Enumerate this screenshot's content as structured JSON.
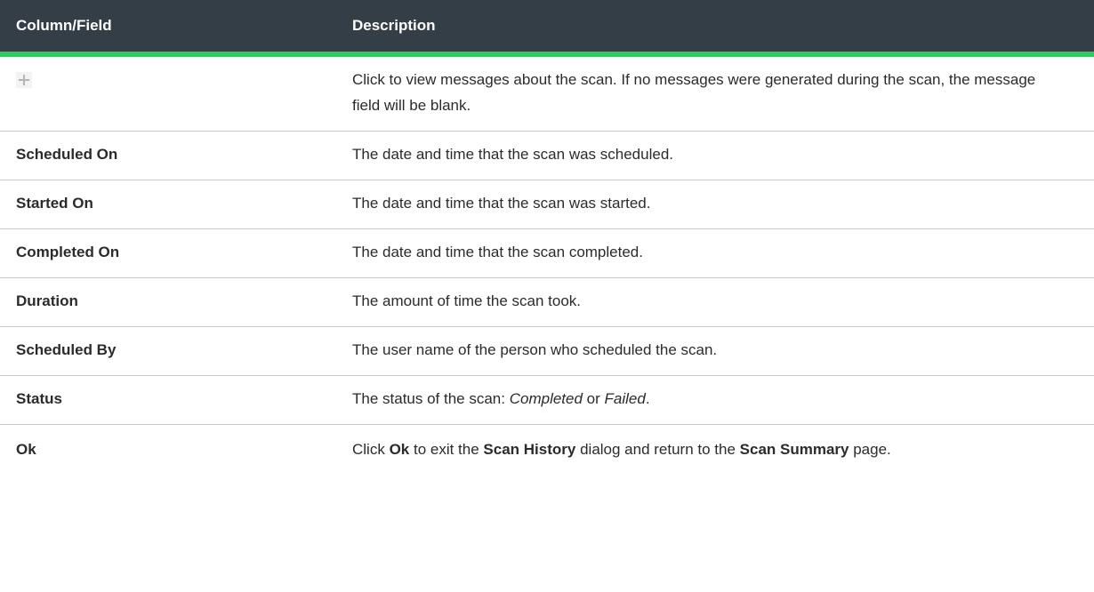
{
  "table": {
    "header": {
      "field": "Column/Field",
      "description": "Description"
    },
    "expand_row": {
      "icon": "plus-icon",
      "description": "Click to view messages about the scan. If no messages were generated during the scan, the message field will be blank."
    },
    "rows": [
      {
        "field": "Scheduled On",
        "description": "The date and time that the scan was scheduled."
      },
      {
        "field": "Started On",
        "description": "The date and time that the scan was started."
      },
      {
        "field": "Completed On",
        "description": "The date and time that the scan completed."
      },
      {
        "field": "Duration",
        "description": "The amount of time the scan took."
      },
      {
        "field": "Scheduled By",
        "description": "The user name of the person who scheduled the scan."
      }
    ],
    "status_row": {
      "field": "Status",
      "pre": "The status of the scan: ",
      "completed": "Completed",
      "or": " or ",
      "failed": "Failed",
      "end": "."
    },
    "ok_row": {
      "field": "Ok",
      "p1": "Click ",
      "ok": "Ok",
      "p2": " to exit the ",
      "dialog": "Scan History",
      "p3": " dialog and return to the ",
      "page": "Scan Summary",
      "p4": " page."
    }
  }
}
